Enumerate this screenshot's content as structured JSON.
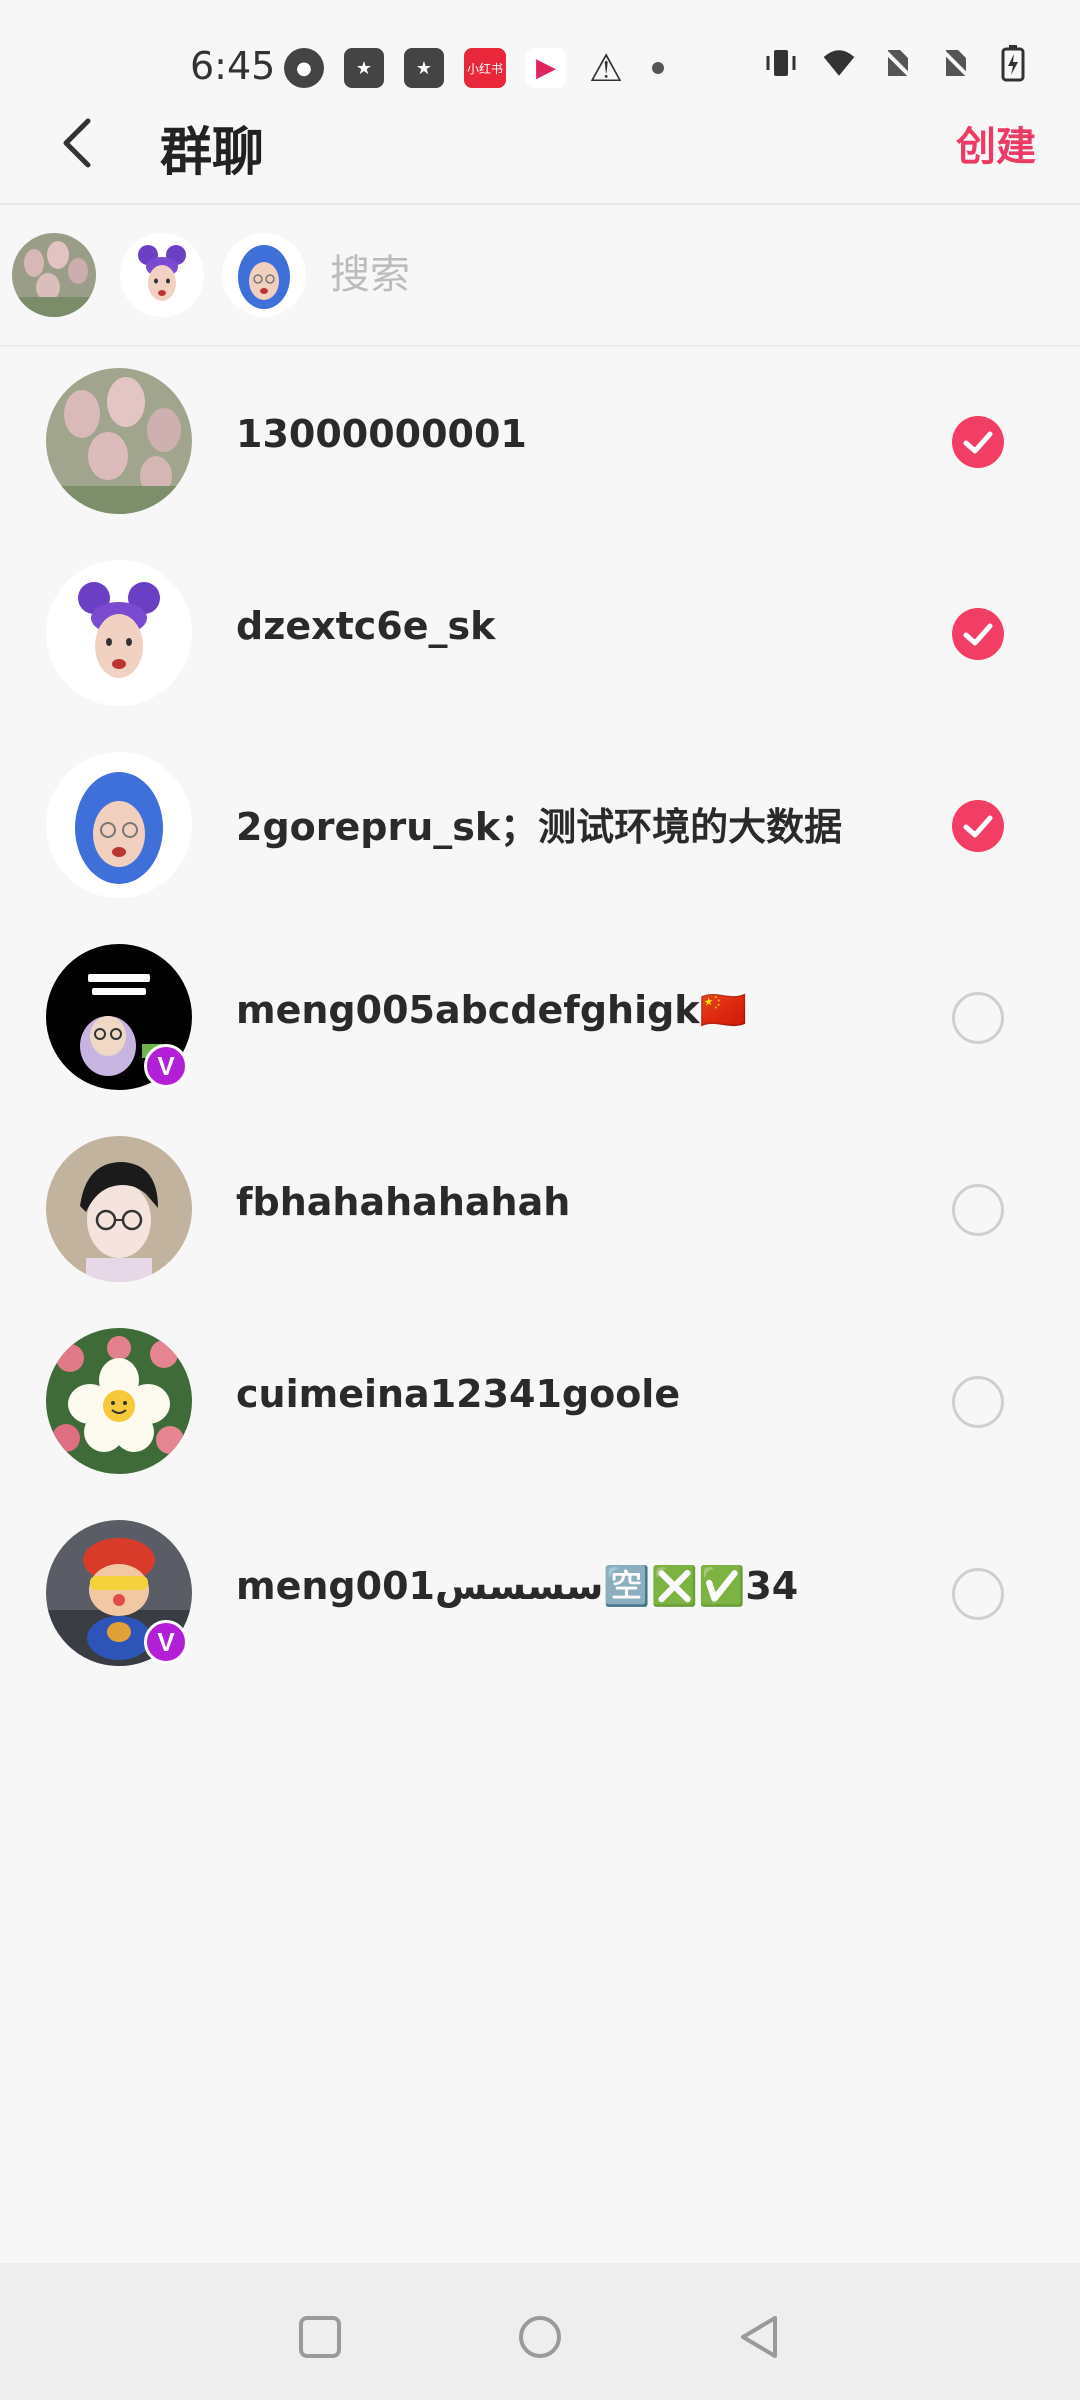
{
  "status_bar": {
    "time": "6:45",
    "icons": [
      "app-icon",
      "star-app-icon",
      "star-app-icon",
      "xiaohongshu-icon",
      "media-app-icon",
      "warning-icon",
      "dot-icon"
    ],
    "xiaohongshu_label": "小红书",
    "right_icons": [
      "vibrate-icon",
      "wifi-icon",
      "no-sim-icon",
      "no-sim-icon",
      "battery-charging-icon"
    ]
  },
  "header": {
    "title": "群聊",
    "create_label": "创建"
  },
  "search": {
    "placeholder": "搜索"
  },
  "selected_count": 3,
  "contacts": [
    {
      "name": "13000000001",
      "selected": true,
      "verified": false,
      "avatar": "tulip-photo"
    },
    {
      "name": "dzextc6e_sk",
      "selected": true,
      "verified": false,
      "avatar": "purple-hair-memoji"
    },
    {
      "name": "2gorepru_sk；测试环境的大数据",
      "selected": true,
      "verified": false,
      "avatar": "blue-hair-memoji"
    },
    {
      "name": "meng005abcdefghigk🇨🇳",
      "selected": false,
      "verified": true,
      "avatar": "dont-touch-phone-meme"
    },
    {
      "name": "fbhahahahahah",
      "selected": false,
      "verified": false,
      "avatar": "anime-boy-glasses"
    },
    {
      "name": "cuimeina12341goole",
      "selected": false,
      "verified": false,
      "avatar": "smiley-flower"
    },
    {
      "name": "meng001سسسس🈳❎✅34",
      "selected": false,
      "verified": true,
      "avatar": "toy-figure"
    }
  ],
  "verified_badge": "V",
  "colors": {
    "accent": "#f23d64",
    "create": "#ef3b63",
    "verified": "#b21fd6"
  }
}
